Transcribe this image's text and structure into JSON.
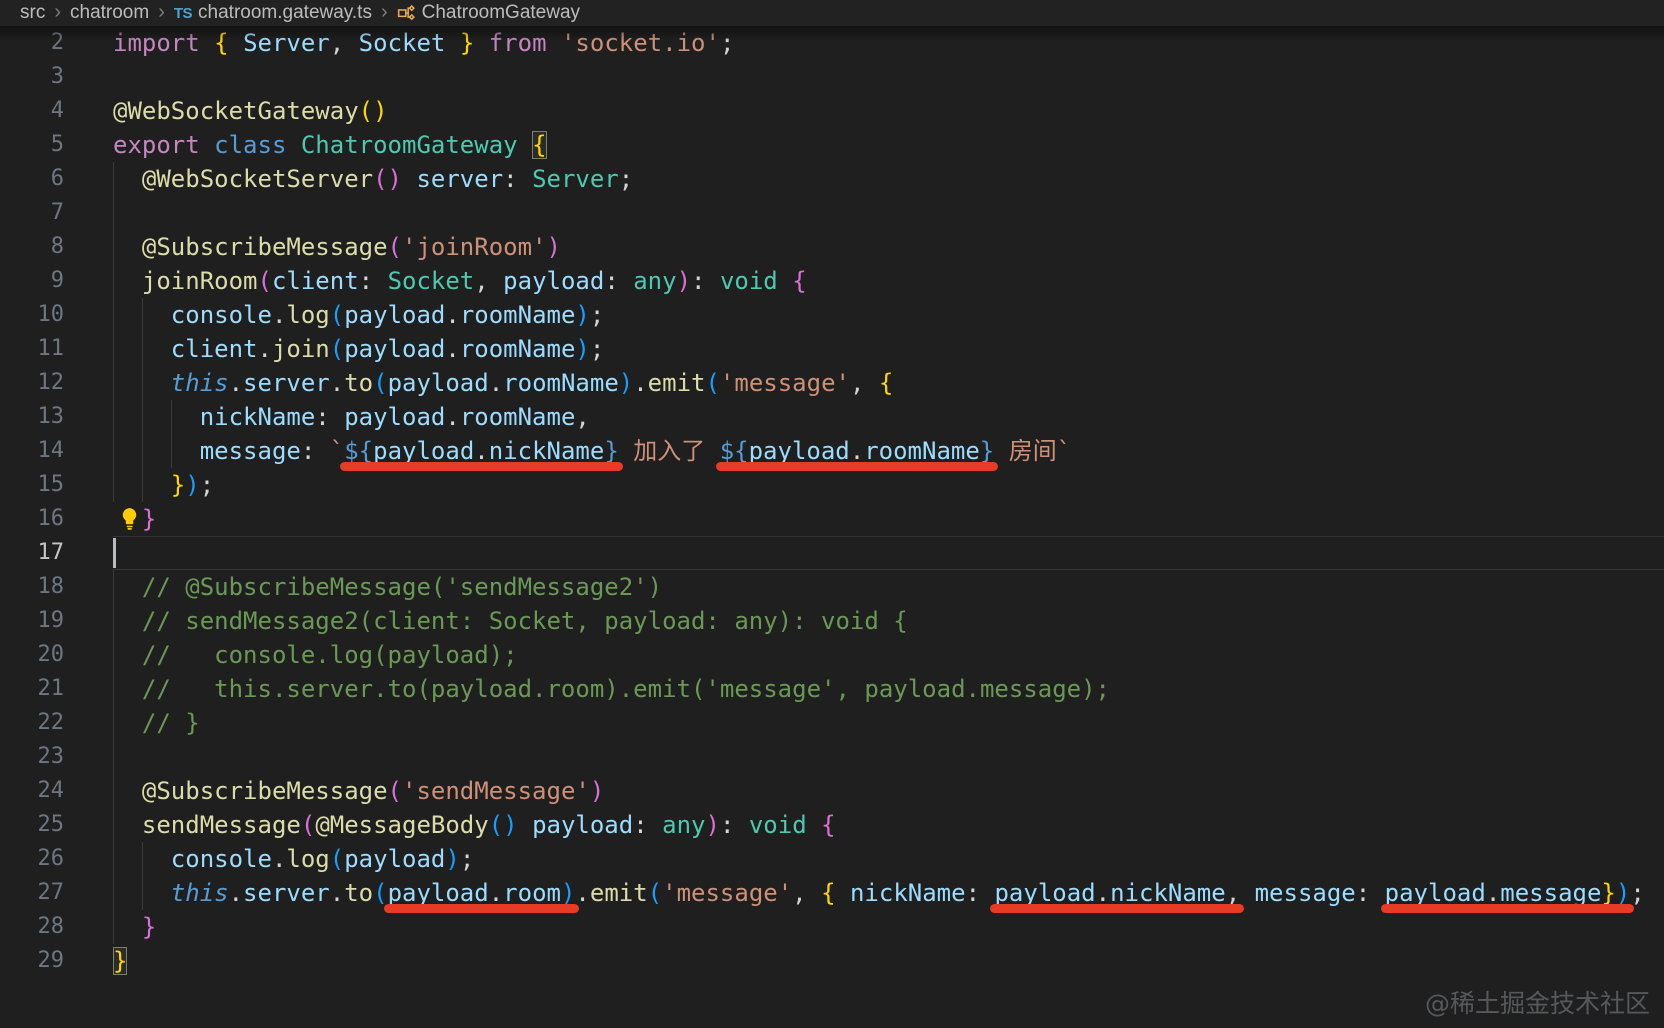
{
  "colors": {
    "background": "#1F1F1F",
    "breadcrumb_bg": "#222222",
    "breadcrumb_text": "#BCBCBC",
    "chevron": "#7E7E7E",
    "ts_icon": "#4EA1D3",
    "class_icon": "#E8AB53",
    "line_number": "#6E7681",
    "line_number_active": "#C6C6C6",
    "guide": "#3B3B3B",
    "annotation": "#E83B26",
    "bulb": "#FFCC00",
    "watermark": "#56585C",
    "kw": "#C586C0",
    "st": "#569CD6",
    "this": "#569CD6",
    "type": "#4EC9B0",
    "var": "#9CDCFE",
    "fn": "#DCDCAA",
    "str": "#CE9178",
    "fg": "#D4D4D4",
    "b1": "#FFD700",
    "b2": "#DA70D6",
    "b3": "#179FFF",
    "cm": "#6A9955",
    "tpl": "#569CD6"
  },
  "breadcrumb": {
    "separator": "›",
    "items": [
      {
        "label": "src"
      },
      {
        "label": "chatroom"
      },
      {
        "label": "chatroom.gateway.ts",
        "icon": "typescript"
      },
      {
        "label": "ChatroomGateway",
        "icon": "class"
      }
    ]
  },
  "watermark": "@稀土掘金技术社区",
  "editor": {
    "lines": [
      {
        "n": 2,
        "tokens": [
          {
            "t": "import",
            "c": "kw"
          },
          {
            "t": " ",
            "c": "fg"
          },
          {
            "t": "{",
            "c": "b1"
          },
          {
            "t": " ",
            "c": "fg"
          },
          {
            "t": "Server",
            "c": "var"
          },
          {
            "t": ", ",
            "c": "fg"
          },
          {
            "t": "Socket",
            "c": "var"
          },
          {
            "t": " ",
            "c": "fg"
          },
          {
            "t": "}",
            "c": "b1"
          },
          {
            "t": " ",
            "c": "fg"
          },
          {
            "t": "from",
            "c": "kw"
          },
          {
            "t": " ",
            "c": "fg"
          },
          {
            "t": "'socket.io'",
            "c": "str"
          },
          {
            "t": ";",
            "c": "fg"
          }
        ]
      },
      {
        "n": 3,
        "tokens": []
      },
      {
        "n": 4,
        "tokens": [
          {
            "t": "@WebSocketGateway",
            "c": "fn"
          },
          {
            "t": "()",
            "c": "b1"
          }
        ]
      },
      {
        "n": 5,
        "tokens": [
          {
            "t": "export",
            "c": "kw"
          },
          {
            "t": " ",
            "c": "fg"
          },
          {
            "t": "class",
            "c": "st"
          },
          {
            "t": " ",
            "c": "fg"
          },
          {
            "t": "ChatroomGateway",
            "c": "type"
          },
          {
            "t": " ",
            "c": "fg"
          },
          {
            "t": "{",
            "c": "b1",
            "m": true
          }
        ]
      },
      {
        "n": 6,
        "g": [
          1
        ],
        "tokens": [
          {
            "t": "  ",
            "c": "fg"
          },
          {
            "t": "@WebSocketServer",
            "c": "fn"
          },
          {
            "t": "()",
            "c": "b2"
          },
          {
            "t": " ",
            "c": "fg"
          },
          {
            "t": "server",
            "c": "var"
          },
          {
            "t": ": ",
            "c": "fg"
          },
          {
            "t": "Server",
            "c": "type"
          },
          {
            "t": ";",
            "c": "fg"
          }
        ]
      },
      {
        "n": 7,
        "g": [
          1
        ],
        "tokens": []
      },
      {
        "n": 8,
        "g": [
          1
        ],
        "tokens": [
          {
            "t": "  ",
            "c": "fg"
          },
          {
            "t": "@SubscribeMessage",
            "c": "fn"
          },
          {
            "t": "(",
            "c": "b2"
          },
          {
            "t": "'joinRoom'",
            "c": "str"
          },
          {
            "t": ")",
            "c": "b2"
          }
        ]
      },
      {
        "n": 9,
        "g": [
          1
        ],
        "tokens": [
          {
            "t": "  ",
            "c": "fg"
          },
          {
            "t": "joinRoom",
            "c": "fn"
          },
          {
            "t": "(",
            "c": "b2"
          },
          {
            "t": "client",
            "c": "var"
          },
          {
            "t": ": ",
            "c": "fg"
          },
          {
            "t": "Socket",
            "c": "type"
          },
          {
            "t": ", ",
            "c": "fg"
          },
          {
            "t": "payload",
            "c": "var"
          },
          {
            "t": ": ",
            "c": "fg"
          },
          {
            "t": "any",
            "c": "type"
          },
          {
            "t": ")",
            "c": "b2"
          },
          {
            "t": ": ",
            "c": "fg"
          },
          {
            "t": "void",
            "c": "type"
          },
          {
            "t": " ",
            "c": "fg"
          },
          {
            "t": "{",
            "c": "b2"
          }
        ]
      },
      {
        "n": 10,
        "g": [
          1,
          3
        ],
        "tokens": [
          {
            "t": "    ",
            "c": "fg"
          },
          {
            "t": "console",
            "c": "var"
          },
          {
            "t": ".",
            "c": "fg"
          },
          {
            "t": "log",
            "c": "fn"
          },
          {
            "t": "(",
            "c": "b3"
          },
          {
            "t": "payload",
            "c": "var"
          },
          {
            "t": ".",
            "c": "fg"
          },
          {
            "t": "roomName",
            "c": "var"
          },
          {
            "t": ")",
            "c": "b3"
          },
          {
            "t": ";",
            "c": "fg"
          }
        ]
      },
      {
        "n": 11,
        "g": [
          1,
          3
        ],
        "tokens": [
          {
            "t": "    ",
            "c": "fg"
          },
          {
            "t": "client",
            "c": "var"
          },
          {
            "t": ".",
            "c": "fg"
          },
          {
            "t": "join",
            "c": "fn"
          },
          {
            "t": "(",
            "c": "b3"
          },
          {
            "t": "payload",
            "c": "var"
          },
          {
            "t": ".",
            "c": "fg"
          },
          {
            "t": "roomName",
            "c": "var"
          },
          {
            "t": ")",
            "c": "b3"
          },
          {
            "t": ";",
            "c": "fg"
          }
        ]
      },
      {
        "n": 12,
        "g": [
          1,
          3
        ],
        "tokens": [
          {
            "t": "    ",
            "c": "fg"
          },
          {
            "t": "this",
            "c": "this"
          },
          {
            "t": ".",
            "c": "fg"
          },
          {
            "t": "server",
            "c": "var"
          },
          {
            "t": ".",
            "c": "fg"
          },
          {
            "t": "to",
            "c": "fn"
          },
          {
            "t": "(",
            "c": "b3"
          },
          {
            "t": "payload",
            "c": "var"
          },
          {
            "t": ".",
            "c": "fg"
          },
          {
            "t": "roomName",
            "c": "var"
          },
          {
            "t": ")",
            "c": "b3"
          },
          {
            "t": ".",
            "c": "fg"
          },
          {
            "t": "emit",
            "c": "fn"
          },
          {
            "t": "(",
            "c": "b3"
          },
          {
            "t": "'message'",
            "c": "str"
          },
          {
            "t": ", ",
            "c": "fg"
          },
          {
            "t": "{",
            "c": "b1"
          }
        ]
      },
      {
        "n": 13,
        "g": [
          1,
          3,
          5
        ],
        "tokens": [
          {
            "t": "      ",
            "c": "fg"
          },
          {
            "t": "nickName",
            "c": "var"
          },
          {
            "t": ": ",
            "c": "fg"
          },
          {
            "t": "payload",
            "c": "var"
          },
          {
            "t": ".",
            "c": "fg"
          },
          {
            "t": "roomName",
            "c": "var"
          },
          {
            "t": ",",
            "c": "fg"
          }
        ]
      },
      {
        "n": 14,
        "g": [
          1,
          3,
          5
        ],
        "tokens": [
          {
            "t": "      ",
            "c": "fg"
          },
          {
            "t": "message",
            "c": "var"
          },
          {
            "t": ": ",
            "c": "fg"
          },
          {
            "t": "`",
            "c": "str"
          },
          {
            "u": true,
            "tokens": [
              {
                "t": "${",
                "c": "tpl"
              },
              {
                "t": "payload",
                "c": "var"
              },
              {
                "t": ".",
                "c": "fg"
              },
              {
                "t": "nickName",
                "c": "var"
              },
              {
                "t": "}",
                "c": "tpl"
              }
            ]
          },
          {
            "t": " 加入了 ",
            "c": "str"
          },
          {
            "u": true,
            "tokens": [
              {
                "t": "${",
                "c": "tpl"
              },
              {
                "t": "payload",
                "c": "var"
              },
              {
                "t": ".",
                "c": "fg"
              },
              {
                "t": "roomName",
                "c": "var"
              },
              {
                "t": "}",
                "c": "tpl"
              }
            ]
          },
          {
            "t": " 房间`",
            "c": "str"
          }
        ]
      },
      {
        "n": 15,
        "g": [
          1,
          3
        ],
        "tokens": [
          {
            "t": "    ",
            "c": "fg"
          },
          {
            "t": "}",
            "c": "b1"
          },
          {
            "t": ")",
            "c": "b3"
          },
          {
            "t": ";",
            "c": "fg"
          }
        ]
      },
      {
        "n": 16,
        "bulb": true,
        "tokens": [
          {
            "t": "  ",
            "c": "fg"
          },
          {
            "t": "}",
            "c": "b2"
          }
        ]
      },
      {
        "n": 17,
        "active": true,
        "cursor": true,
        "tokens": []
      },
      {
        "n": 18,
        "g": [
          1
        ],
        "tokens": [
          {
            "t": "  ",
            "c": "fg"
          },
          {
            "t": "// @SubscribeMessage('sendMessage2')",
            "c": "cm"
          }
        ]
      },
      {
        "n": 19,
        "g": [
          1
        ],
        "tokens": [
          {
            "t": "  ",
            "c": "fg"
          },
          {
            "t": "// sendMessage2(client: Socket, payload: any): void {",
            "c": "cm"
          }
        ]
      },
      {
        "n": 20,
        "g": [
          1
        ],
        "tokens": [
          {
            "t": "  ",
            "c": "fg"
          },
          {
            "t": "//   console.log(payload);",
            "c": "cm"
          }
        ]
      },
      {
        "n": 21,
        "g": [
          1
        ],
        "tokens": [
          {
            "t": "  ",
            "c": "fg"
          },
          {
            "t": "//   this.server.to(payload.room).emit('message', payload.message);",
            "c": "cm"
          }
        ]
      },
      {
        "n": 22,
        "g": [
          1
        ],
        "tokens": [
          {
            "t": "  ",
            "c": "fg"
          },
          {
            "t": "// }",
            "c": "cm"
          }
        ]
      },
      {
        "n": 23,
        "g": [
          1
        ],
        "tokens": []
      },
      {
        "n": 24,
        "g": [
          1
        ],
        "tokens": [
          {
            "t": "  ",
            "c": "fg"
          },
          {
            "t": "@SubscribeMessage",
            "c": "fn"
          },
          {
            "t": "(",
            "c": "b2"
          },
          {
            "t": "'sendMessage'",
            "c": "str"
          },
          {
            "t": ")",
            "c": "b2"
          }
        ]
      },
      {
        "n": 25,
        "g": [
          1
        ],
        "tokens": [
          {
            "t": "  ",
            "c": "fg"
          },
          {
            "t": "sendMessage",
            "c": "fn"
          },
          {
            "t": "(",
            "c": "b2"
          },
          {
            "t": "@MessageBody",
            "c": "fn"
          },
          {
            "t": "()",
            "c": "b3"
          },
          {
            "t": " ",
            "c": "fg"
          },
          {
            "t": "payload",
            "c": "var"
          },
          {
            "t": ": ",
            "c": "fg"
          },
          {
            "t": "any",
            "c": "type"
          },
          {
            "t": ")",
            "c": "b2"
          },
          {
            "t": ": ",
            "c": "fg"
          },
          {
            "t": "void",
            "c": "type"
          },
          {
            "t": " ",
            "c": "fg"
          },
          {
            "t": "{",
            "c": "b2"
          }
        ]
      },
      {
        "n": 26,
        "g": [
          1,
          3
        ],
        "tokens": [
          {
            "t": "    ",
            "c": "fg"
          },
          {
            "t": "console",
            "c": "var"
          },
          {
            "t": ".",
            "c": "fg"
          },
          {
            "t": "log",
            "c": "fn"
          },
          {
            "t": "(",
            "c": "b3"
          },
          {
            "t": "payload",
            "c": "var"
          },
          {
            "t": ")",
            "c": "b3"
          },
          {
            "t": ";",
            "c": "fg"
          }
        ]
      },
      {
        "n": 27,
        "g": [
          1,
          3
        ],
        "tokens": [
          {
            "t": "    ",
            "c": "fg"
          },
          {
            "t": "this",
            "c": "this"
          },
          {
            "t": ".",
            "c": "fg"
          },
          {
            "t": "server",
            "c": "var"
          },
          {
            "t": ".",
            "c": "fg"
          },
          {
            "t": "to",
            "c": "fn"
          },
          {
            "t": "(",
            "c": "b3"
          },
          {
            "u": true,
            "tokens": [
              {
                "t": "payload",
                "c": "var"
              },
              {
                "t": ".",
                "c": "fg"
              },
              {
                "t": "room",
                "c": "var"
              },
              {
                "t": ")",
                "c": "b3"
              }
            ]
          },
          {
            "t": ".",
            "c": "fg"
          },
          {
            "t": "emit",
            "c": "fn"
          },
          {
            "t": "(",
            "c": "b3"
          },
          {
            "t": "'message'",
            "c": "str"
          },
          {
            "t": ", ",
            "c": "fg"
          },
          {
            "t": "{",
            "c": "b1"
          },
          {
            "t": " ",
            "c": "fg"
          },
          {
            "t": "nickName",
            "c": "var"
          },
          {
            "t": ": ",
            "c": "fg"
          },
          {
            "u": true,
            "tokens": [
              {
                "t": "payload",
                "c": "var"
              },
              {
                "t": ".",
                "c": "fg"
              },
              {
                "t": "nickName",
                "c": "var"
              },
              {
                "t": ",",
                "c": "fg"
              }
            ]
          },
          {
            "t": " ",
            "c": "fg"
          },
          {
            "t": "message",
            "c": "var"
          },
          {
            "t": ": ",
            "c": "fg"
          },
          {
            "u": true,
            "tokens": [
              {
                "t": "payload",
                "c": "var"
              },
              {
                "t": ".",
                "c": "fg"
              },
              {
                "t": "message",
                "c": "var"
              },
              {
                "t": "}",
                "c": "b1"
              },
              {
                "t": ")",
                "c": "b3"
              }
            ]
          },
          {
            "t": ";",
            "c": "fg"
          }
        ]
      },
      {
        "n": 28,
        "g": [
          1
        ],
        "tokens": [
          {
            "t": "  ",
            "c": "fg"
          },
          {
            "t": "}",
            "c": "b2"
          }
        ]
      },
      {
        "n": 29,
        "tokens": [
          {
            "t": "}",
            "c": "b1",
            "m": true
          }
        ]
      }
    ]
  }
}
